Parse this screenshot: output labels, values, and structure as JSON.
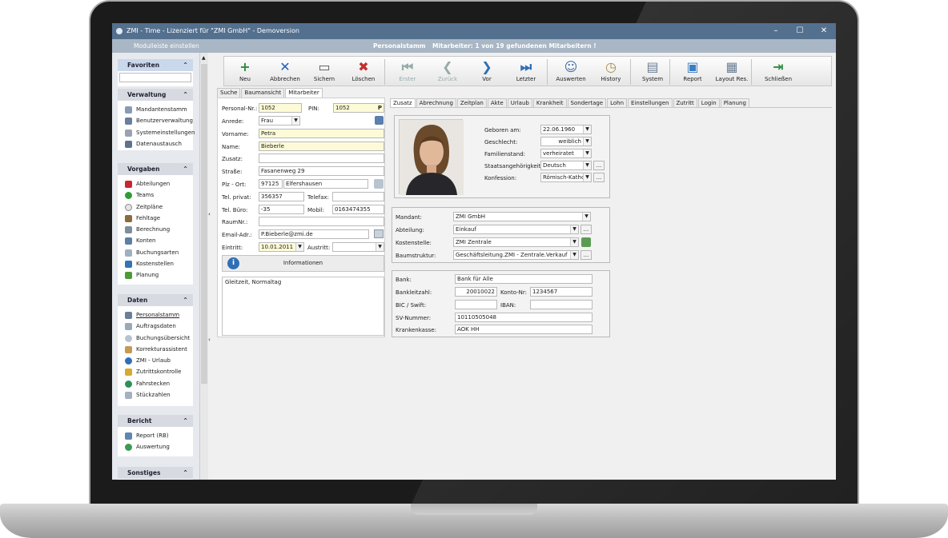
{
  "window": {
    "title": "ZMI - Time - Lizenziert für \"ZMI GmbH\" - Demoversion",
    "min": "–",
    "max": "☐",
    "close": "✕"
  },
  "statusbar": {
    "left": "Modulleiste einstellen",
    "center": "Personalstamm",
    "right": "Mitarbeiter: 1 von 19 gefundenen Mitarbeitern !"
  },
  "sidebar": {
    "favoriten": {
      "title": "Favoriten",
      "items": []
    },
    "verwaltung": {
      "title": "Verwaltung",
      "items": [
        "Mandantenstamm",
        "Benutzerverwaltung",
        "Systemeinstellungen",
        "Datenaustausch"
      ]
    },
    "vorgaben": {
      "title": "Vorgaben",
      "items": [
        "Abteilungen",
        "Teams",
        "Zeitpläne",
        "Fehltage",
        "Berechnung",
        "Konten",
        "Buchungsarten",
        "Kostenstellen",
        "Planung"
      ]
    },
    "daten": {
      "title": "Daten",
      "items": [
        "Personalstamm",
        "Auftragsdaten",
        "Buchungsübersicht",
        "Korrekturassistent",
        "ZMI - Urlaub",
        "Zutrittskontrolle",
        "Fahrstecken",
        "Stückzahlen"
      ]
    },
    "bericht": {
      "title": "Bericht",
      "items": [
        "Report (RB)",
        "Auswertung"
      ]
    },
    "sonstiges": {
      "title": "Sonstiges"
    }
  },
  "toolbar": [
    "Neu",
    "Abbrechen",
    "Sichern",
    "Löschen",
    "Erster",
    "Zurück",
    "Vor",
    "Letzter",
    "Auswerten",
    "History",
    "System",
    "Report",
    "Layout Res.",
    "Schließen"
  ],
  "left_tabs": [
    "Suche",
    "Baumansicht",
    "Mitarbeiter"
  ],
  "right_tabs": [
    "Zusatz",
    "Abrechnung",
    "Zeitplan",
    "Akte",
    "Urlaub",
    "Krankheit",
    "Sondertage",
    "Lohn",
    "Einstellungen",
    "Zutritt",
    "Login",
    "Planung"
  ],
  "form": {
    "personal_nr_label": "Personal-Nr.:",
    "personal_nr": "1052",
    "pin_label": "PIN:",
    "pin": "1052",
    "pin_btn": "P",
    "anrede_label": "Anrede:",
    "anrede": "Frau",
    "vorname_label": "Vorname:",
    "vorname": "Petra",
    "name_label": "Name:",
    "name": "Bieberle",
    "zusatz_label": "Zusatz:",
    "zusatz": "",
    "strasse_label": "Straße:",
    "strasse": "Fasanenweg 29",
    "plz_label": "Plz - Ort:",
    "plz": "97125",
    "ort": "Elfershausen",
    "tel_privat_label": "Tel. privat:",
    "tel_privat": "356357",
    "telefax_label": "Telefax:",
    "telefax": "",
    "tel_buero_label": "Tel. Büro:",
    "tel_buero": "-35",
    "mobil_label": "Mobil:",
    "mobil": "0163474355",
    "raumnr_label": "RaumNr.:",
    "raumnr": "",
    "email_label": "Email-Adr.:",
    "email": "P.Bieberle@zmi.de",
    "eintritt_label": "Eintritt:",
    "eintritt": "10.01.2011",
    "austritt_label": "Austritt:",
    "austritt": "",
    "info_btn": "Informationen",
    "notes": "Gleitzeit, Normaltag"
  },
  "zusatz": {
    "geboren_label": "Geboren am:",
    "geboren": "22.06.1960",
    "geschlecht_label": "Geschlecht:",
    "geschlecht": "weiblich",
    "familienstand_label": "Familienstand:",
    "familienstand": "verheiratet",
    "staatsang_label": "Staatsangehörigkeit:",
    "staatsang": "Deutsch",
    "konfession_label": "Konfession:",
    "konfession": "Römisch-Katholis",
    "mandant_label": "Mandant:",
    "mandant": "ZMI GmbH",
    "abteilung_label": "Abteilung:",
    "abteilung": "Einkauf",
    "kostenstelle_label": "Kostenstelle:",
    "kostenstelle": "ZMI Zentrale",
    "baumstruktur_label": "Baumstruktur:",
    "baumstruktur": "Geschäftsleitung.ZMI - Zentrale.Verkauf",
    "bank_label": "Bank:",
    "bank": "Bank für Alle",
    "blz_label": "Bankleitzahl:",
    "blz": "20010022",
    "konto_label": "Konto-Nr:",
    "konto": "1234567",
    "bic_label": "BIC / Swift:",
    "bic": "",
    "iban_label": "IBAN:",
    "iban": "",
    "sv_label": "SV-Nummer:",
    "sv": "10110505048",
    "kk_label": "Krankenkasse:",
    "kk": "AOK HH",
    "dots": "..."
  }
}
